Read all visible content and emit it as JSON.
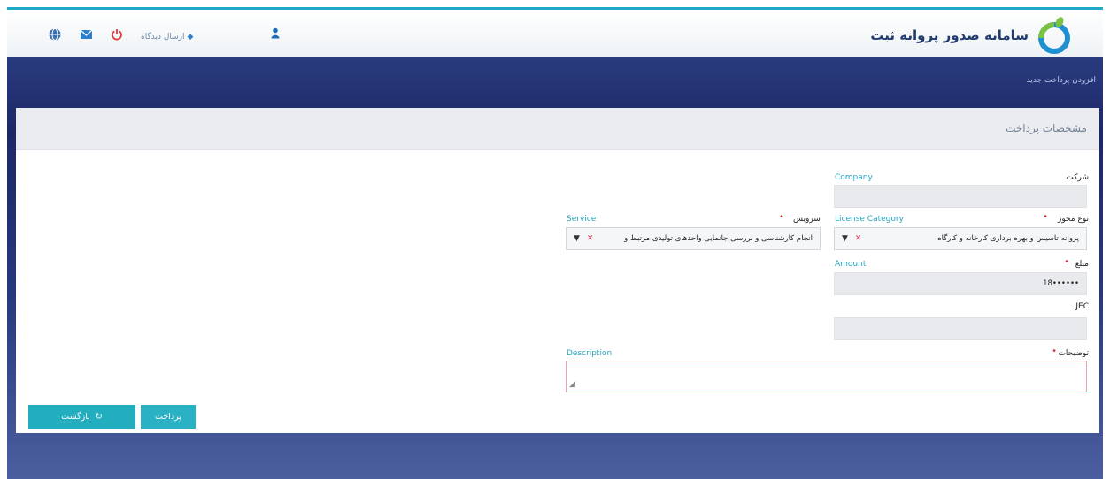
{
  "header": {
    "brand_title": "سامانه صدور پروانه ثبت",
    "send_link_label": "ارسال دیدگاه",
    "icons": [
      "globe-icon",
      "mail-icon",
      "power-icon",
      "user-icon"
    ]
  },
  "nav": {
    "new_payment_label": "افزودن پرداخت جدید"
  },
  "panel": {
    "title": "مشخصات پرداخت"
  },
  "form": {
    "company": {
      "label_fa": "شرکت",
      "label_en": "Company",
      "value": ""
    },
    "license_category": {
      "label_fa": "نوع مجوز",
      "label_en": "License Category",
      "value": "پروانه تاسیس و بهره برداری کارخانه و کارگاه"
    },
    "service": {
      "label_fa": "سرویس",
      "label_en": "Service",
      "value": "انجام کارشناسی و بررسی جانمایی واحدهای تولیدی مرتبط و"
    },
    "amount": {
      "label_fa": "مبلغ",
      "label_en": "Amount",
      "value": "18••••••"
    },
    "vat": {
      "label_fa": "JEC",
      "value": ""
    },
    "description": {
      "label_fa": "توضیحات",
      "label_en": "Description",
      "value": ""
    }
  },
  "buttons": {
    "pay_label": "پرداخت",
    "back_label": "بازگشت"
  },
  "colors": {
    "accent": "#23aebf",
    "header_dark": "#1c2766",
    "required": "#d8364d",
    "english_label": "#27a4bd"
  }
}
